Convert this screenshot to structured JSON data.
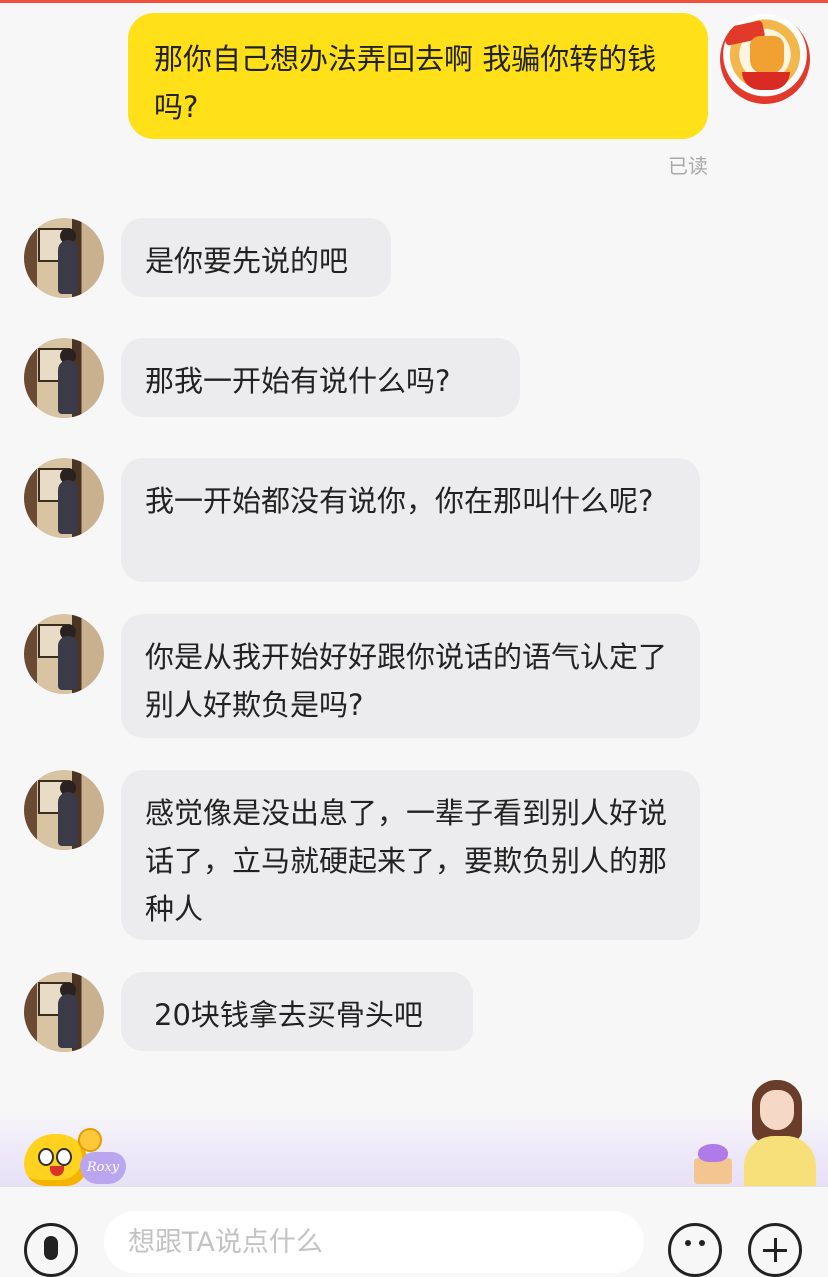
{
  "conversation": {
    "outgoing": {
      "text": "那你自己想办法弄回去啊 我骗你转的钱吗?",
      "status": "已读"
    },
    "incoming": [
      {
        "text": "是你要先说的吧"
      },
      {
        "text": "那我一开始有说什么吗?"
      },
      {
        "text": "我一开始都没有说你，你在那叫什么呢?"
      },
      {
        "text": "你是从我开始好好跟你说话的语气认定了别人好欺负是吗?"
      },
      {
        "text": "感觉像是没出息了，一辈子看到别人好说话了，立马就硬起来了，要欺负别人的那种人"
      },
      {
        "text": "20块钱拿去买骨头吧"
      }
    ]
  },
  "decorations": {
    "heart_badge_text": "Roxy"
  },
  "input_bar": {
    "placeholder": "想跟TA说点什么"
  },
  "icons": {
    "voice": "microphone-icon",
    "emoji": "smiley-icon",
    "more": "plus-icon"
  },
  "colors": {
    "outgoing_bubble": "#ffe019",
    "incoming_bubble": "#ececee",
    "background": "#f7f7f7",
    "top_accent": "#f0503c"
  }
}
